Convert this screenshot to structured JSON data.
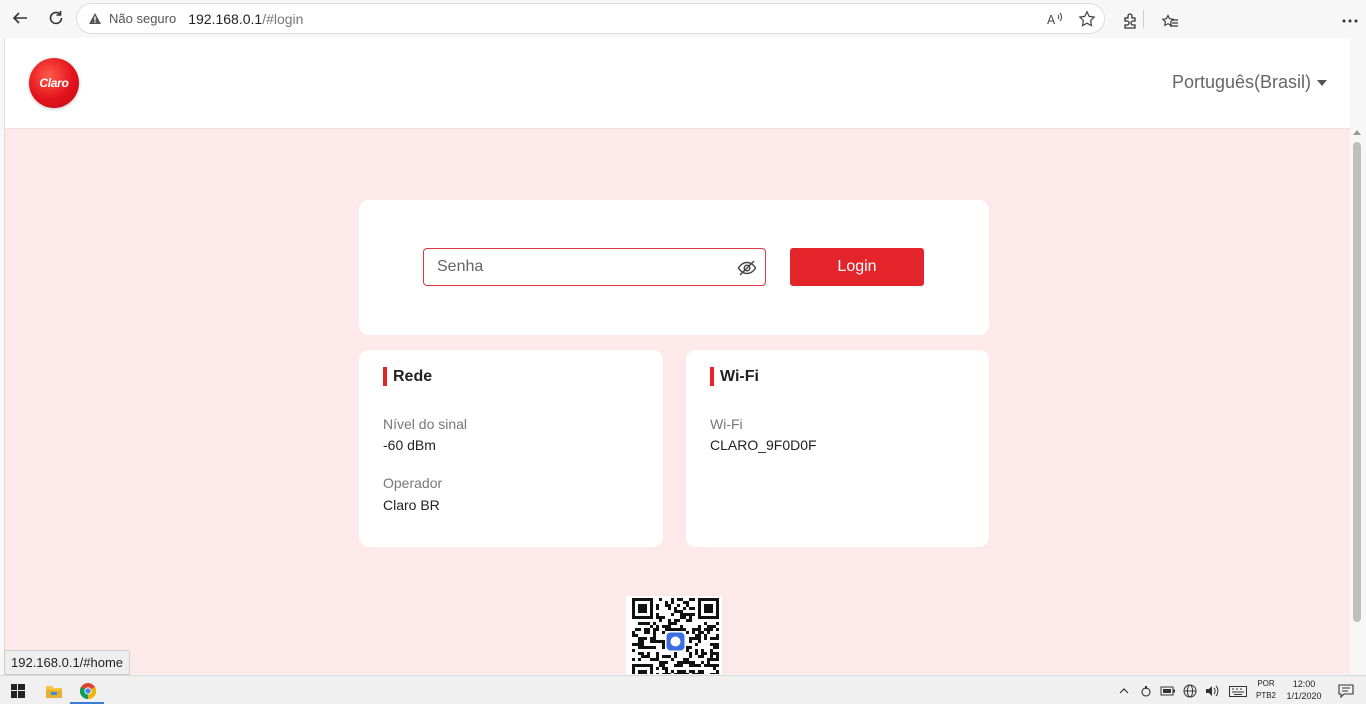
{
  "browser": {
    "not_secure_label": "Não seguro",
    "url_host": "192.168.0.1",
    "url_path": "/#login",
    "status_url": "192.168.0.1/#home"
  },
  "header": {
    "logo_text": "Claro",
    "language": "Português(Brasil)"
  },
  "login": {
    "password_placeholder": "Senha",
    "login_button": "Login"
  },
  "rede": {
    "title": "Rede",
    "signal_label": "Nível do sinal",
    "signal_value": "-60 dBm",
    "operator_label": "Operador",
    "operator_value": "Claro BR"
  },
  "wifi": {
    "title": "Wi-Fi",
    "ssid_label": "Wi-Fi",
    "ssid_value": "CLARO_9F0D0F"
  },
  "taskbar": {
    "input_lang_line1": "POR",
    "input_lang_line2": "PTB2",
    "time": "12:00",
    "date": "1/1/2020"
  },
  "colors": {
    "brand_red": "#e3242b",
    "page_bg": "#fde9e9"
  }
}
